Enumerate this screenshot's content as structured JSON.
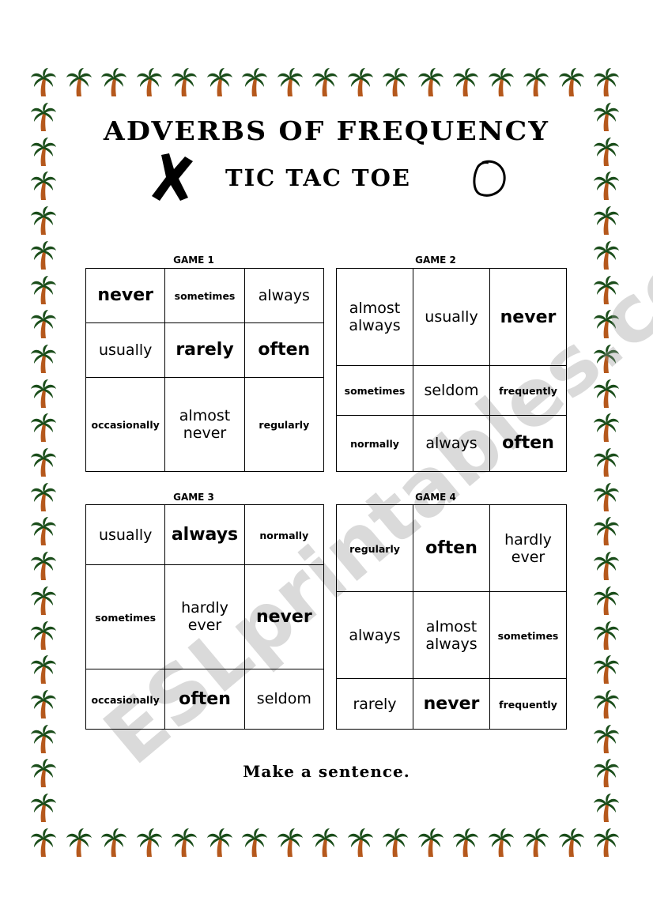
{
  "page": {
    "title": "ADVERBS OF FREQUENCY",
    "subtitle": "TIC TAC TOE",
    "x_symbol": "x-mark-icon",
    "o_symbol": "o-mark-icon",
    "footer": "Make a sentence.",
    "watermark": "ESLprintables.com",
    "border_icon": "palm-tree-icon",
    "colors": {
      "palm_leaves": "#1a4d1a",
      "palm_trunk": "#b5581c",
      "watermark": "#b4b4b4"
    }
  },
  "games": [
    {
      "label": "GAME 1",
      "cells": [
        [
          {
            "text": "never",
            "size": "l"
          },
          {
            "text": "sometimes",
            "size": "s"
          },
          {
            "text": "always",
            "size": "m"
          }
        ],
        [
          {
            "text": "usually",
            "size": "m"
          },
          {
            "text": "rarely",
            "size": "l"
          },
          {
            "text": "often",
            "size": "l"
          }
        ],
        [
          {
            "text": "occasionally",
            "size": "s"
          },
          {
            "text": "almost never",
            "size": "m"
          },
          {
            "text": "regularly",
            "size": "s"
          }
        ]
      ]
    },
    {
      "label": "GAME 2",
      "cells": [
        [
          {
            "text": "almost always",
            "size": "m"
          },
          {
            "text": "usually",
            "size": "m"
          },
          {
            "text": "never",
            "size": "l"
          }
        ],
        [
          {
            "text": "sometimes",
            "size": "s"
          },
          {
            "text": "seldom",
            "size": "m"
          },
          {
            "text": "frequently",
            "size": "s"
          }
        ],
        [
          {
            "text": "normally",
            "size": "s"
          },
          {
            "text": "always",
            "size": "m"
          },
          {
            "text": "often",
            "size": "l"
          }
        ]
      ]
    },
    {
      "label": "GAME 3",
      "cells": [
        [
          {
            "text": "usually",
            "size": "m"
          },
          {
            "text": "always",
            "size": "l"
          },
          {
            "text": "normally",
            "size": "s"
          }
        ],
        [
          {
            "text": "sometimes",
            "size": "s"
          },
          {
            "text": "hardly ever",
            "size": "m"
          },
          {
            "text": "never",
            "size": "l"
          }
        ],
        [
          {
            "text": "occasionally",
            "size": "s"
          },
          {
            "text": "often",
            "size": "l"
          },
          {
            "text": "seldom",
            "size": "m"
          }
        ]
      ]
    },
    {
      "label": "GAME 4",
      "cells": [
        [
          {
            "text": "regularly",
            "size": "s"
          },
          {
            "text": "often",
            "size": "l"
          },
          {
            "text": "hardly ever",
            "size": "m"
          }
        ],
        [
          {
            "text": "always",
            "size": "m"
          },
          {
            "text": "almost always",
            "size": "m"
          },
          {
            "text": "sometimes",
            "size": "s"
          }
        ],
        [
          {
            "text": "rarely",
            "size": "m"
          },
          {
            "text": "never",
            "size": "l"
          },
          {
            "text": "frequently",
            "size": "s"
          }
        ]
      ]
    }
  ]
}
